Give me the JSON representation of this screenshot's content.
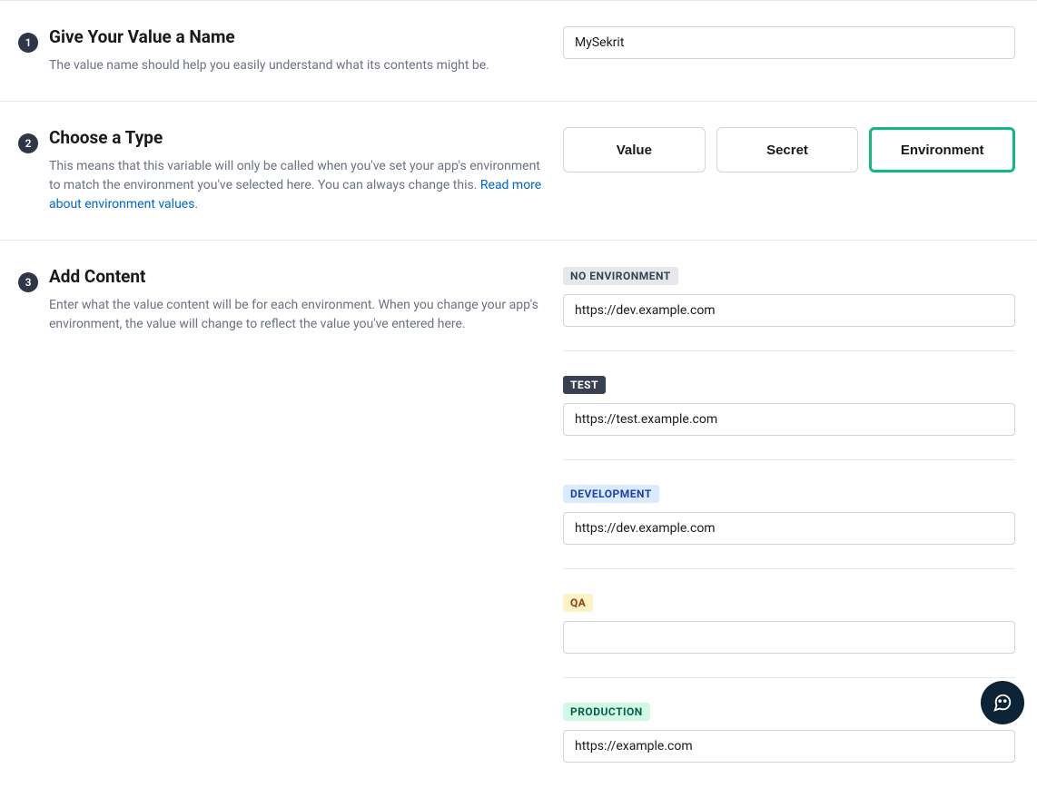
{
  "step1": {
    "num": "1",
    "title": "Give Your Value a Name",
    "desc": "The value name should help you easily understand what its contents might be.",
    "value": "MySekrit"
  },
  "step2": {
    "num": "2",
    "title": "Choose a Type",
    "desc": "This means that this variable will only be called when you've set your app's environment to match the environment you've selected here. You can always change this. ",
    "link": "Read more about environment values",
    "types": {
      "value": "Value",
      "secret": "Secret",
      "environment": "Environment"
    }
  },
  "step3": {
    "num": "3",
    "title": "Add Content",
    "desc": "Enter what the value content will be for each environment. When you change your app's environment, the value will change to reflect the value you've entered here.",
    "envs": [
      {
        "label": "NO ENVIRONMENT",
        "value": "https://dev.example.com",
        "tagClass": "tag-gray"
      },
      {
        "label": "TEST",
        "value": "https://test.example.com",
        "tagClass": "tag-dark"
      },
      {
        "label": "DEVELOPMENT",
        "value": "https://dev.example.com",
        "tagClass": "tag-blue"
      },
      {
        "label": "QA",
        "value": "",
        "tagClass": "tag-yellow"
      },
      {
        "label": "PRODUCTION",
        "value": "https://example.com",
        "tagClass": "tag-green"
      }
    ]
  }
}
